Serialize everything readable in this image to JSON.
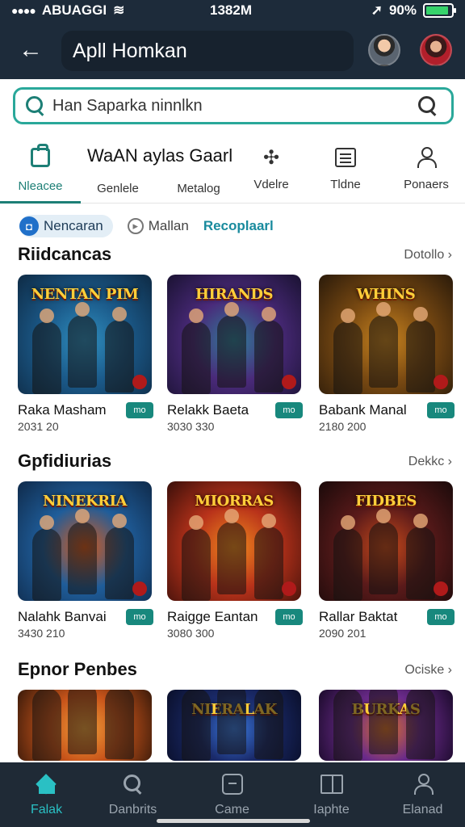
{
  "status": {
    "carrier": "ABUAGGI",
    "time": "1382M",
    "battery": "90%",
    "battery_level": 0.9
  },
  "header": {
    "title": "Apll Homkan"
  },
  "search": {
    "placeholder": "Han Saparka ninnlkn"
  },
  "categories": {
    "heading": "WaAN aylas Gaarl",
    "items": [
      {
        "label": "Nleacee",
        "icon": "bag-icon"
      },
      {
        "label": "Genlele",
        "icon": "bag-icon"
      },
      {
        "label": "Metalog",
        "icon": "controller-icon"
      },
      {
        "label": "Vdelre",
        "icon": "puzzle-icon"
      },
      {
        "label": "Tldne",
        "icon": "list-icon"
      },
      {
        "label": "Ponaers",
        "icon": "person-icon"
      }
    ]
  },
  "chips": [
    {
      "label": "Nencaran"
    },
    {
      "label": "Mallan"
    },
    {
      "label": "Recoplaarl"
    }
  ],
  "sections": [
    {
      "title": "Riidcancas",
      "more": "Dotollo",
      "cards": [
        {
          "name": "Raka Masham",
          "stat": "2031 20",
          "badge": "mo",
          "banner": "NENTAN PIM",
          "bg": [
            "#1b5a8a",
            "#2f8fbf",
            "#0e2a44"
          ]
        },
        {
          "name": "Relakk Baeta",
          "stat": "3030 330",
          "badge": "mo",
          "banner": "HIRANDS",
          "bg": [
            "#4a2a7a",
            "#2f7f9a",
            "#1a1232"
          ]
        },
        {
          "name": "Babank Manal",
          "stat": "2180 200",
          "badge": "mo",
          "banner": "WHINS",
          "bg": [
            "#7a4a12",
            "#c8841f",
            "#2a1a0a"
          ]
        }
      ]
    },
    {
      "title": "Gpfidiurias",
      "more": "Dekkc",
      "cards": [
        {
          "name": "Nalahk Banvai",
          "stat": "3430 210",
          "badge": "mo",
          "banner": "NINEKRIA",
          "bg": [
            "#1f5d9a",
            "#d85a1a",
            "#0f2a4a"
          ]
        },
        {
          "name": "Raigge Eantan",
          "stat": "3080 300",
          "badge": "mo",
          "banner": "MIORRAS",
          "bg": [
            "#b8321a",
            "#f08a1e",
            "#3a0f0a"
          ]
        },
        {
          "name": "Rallar Baktat",
          "stat": "2090 201",
          "badge": "mo",
          "banner": "FIDBES",
          "bg": [
            "#5a1a1a",
            "#c84a1a",
            "#1a0a0a"
          ]
        }
      ]
    },
    {
      "title": "Epnor Penbes",
      "more": "Ociske",
      "cards": [
        {
          "name": "",
          "stat": "",
          "badge": "",
          "banner": "",
          "bg": [
            "#c8541a",
            "#f0a03a",
            "#3a1a0a"
          ]
        },
        {
          "name": "",
          "stat": "",
          "badge": "",
          "banner": "NIERALAK",
          "bg": [
            "#1a2a6a",
            "#3a7adf",
            "#0a0f2a"
          ]
        },
        {
          "name": "",
          "stat": "",
          "badge": "",
          "banner": "BURKAS",
          "bg": [
            "#6a2a8a",
            "#d8702a",
            "#1a0a2a"
          ]
        }
      ]
    }
  ],
  "bottom_nav": [
    {
      "label": "Falak",
      "icon": "home-icon"
    },
    {
      "label": "Danbrits",
      "icon": "search-icon"
    },
    {
      "label": "Came",
      "icon": "box-icon"
    },
    {
      "label": "Iaphte",
      "icon": "book-icon"
    },
    {
      "label": "Elanad",
      "icon": "person-icon"
    }
  ],
  "colors": {
    "accent": "#1d7f76",
    "topbar": "#1d2b3a",
    "bottombar": "#1f2a36",
    "active_nav": "#2ac0c4"
  }
}
